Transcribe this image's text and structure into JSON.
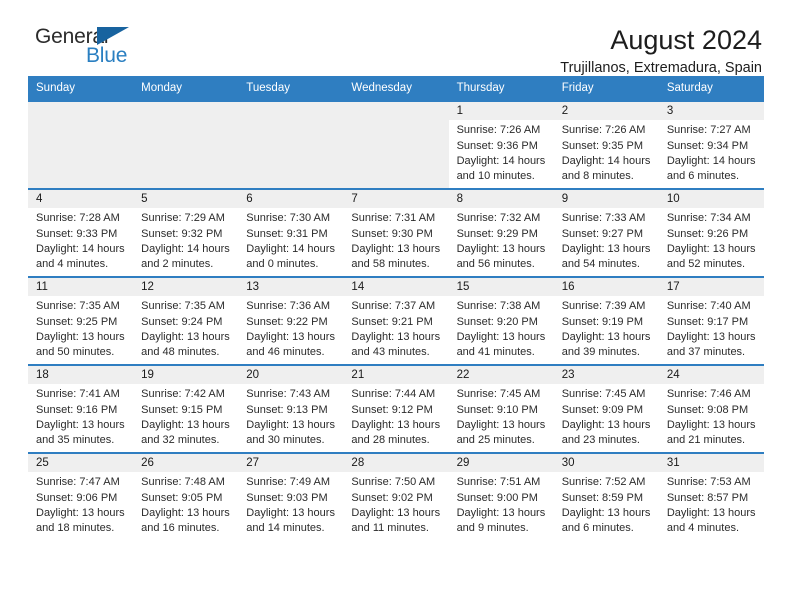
{
  "logo": {
    "word_one": "General",
    "word_two": "Blue",
    "triangle_icon": "triangle-icon"
  },
  "header": {
    "title": "August 2024",
    "subtitle": "Trujillanos, Extremadura, Spain"
  },
  "colors": {
    "header_blue": "#2f7ec1",
    "logo_blue": "#2a7fc1",
    "row_divider": "#2f7ec1",
    "daynum_band": "#efefef"
  },
  "calendar": {
    "weekday_headers": [
      "Sunday",
      "Monday",
      "Tuesday",
      "Wednesday",
      "Thursday",
      "Friday",
      "Saturday"
    ],
    "weeks": [
      [
        {
          "empty": true,
          "day": "",
          "sunrise": "",
          "sunset": "",
          "daylight1": "",
          "daylight2": ""
        },
        {
          "empty": true,
          "day": "",
          "sunrise": "",
          "sunset": "",
          "daylight1": "",
          "daylight2": ""
        },
        {
          "empty": true,
          "day": "",
          "sunrise": "",
          "sunset": "",
          "daylight1": "",
          "daylight2": ""
        },
        {
          "empty": true,
          "day": "",
          "sunrise": "",
          "sunset": "",
          "daylight1": "",
          "daylight2": ""
        },
        {
          "empty": false,
          "day": "1",
          "sunrise": "Sunrise: 7:26 AM",
          "sunset": "Sunset: 9:36 PM",
          "daylight1": "Daylight: 14 hours",
          "daylight2": "and 10 minutes."
        },
        {
          "empty": false,
          "day": "2",
          "sunrise": "Sunrise: 7:26 AM",
          "sunset": "Sunset: 9:35 PM",
          "daylight1": "Daylight: 14 hours",
          "daylight2": "and 8 minutes."
        },
        {
          "empty": false,
          "day": "3",
          "sunrise": "Sunrise: 7:27 AM",
          "sunset": "Sunset: 9:34 PM",
          "daylight1": "Daylight: 14 hours",
          "daylight2": "and 6 minutes."
        }
      ],
      [
        {
          "empty": false,
          "day": "4",
          "sunrise": "Sunrise: 7:28 AM",
          "sunset": "Sunset: 9:33 PM",
          "daylight1": "Daylight: 14 hours",
          "daylight2": "and 4 minutes."
        },
        {
          "empty": false,
          "day": "5",
          "sunrise": "Sunrise: 7:29 AM",
          "sunset": "Sunset: 9:32 PM",
          "daylight1": "Daylight: 14 hours",
          "daylight2": "and 2 minutes."
        },
        {
          "empty": false,
          "day": "6",
          "sunrise": "Sunrise: 7:30 AM",
          "sunset": "Sunset: 9:31 PM",
          "daylight1": "Daylight: 14 hours",
          "daylight2": "and 0 minutes."
        },
        {
          "empty": false,
          "day": "7",
          "sunrise": "Sunrise: 7:31 AM",
          "sunset": "Sunset: 9:30 PM",
          "daylight1": "Daylight: 13 hours",
          "daylight2": "and 58 minutes."
        },
        {
          "empty": false,
          "day": "8",
          "sunrise": "Sunrise: 7:32 AM",
          "sunset": "Sunset: 9:29 PM",
          "daylight1": "Daylight: 13 hours",
          "daylight2": "and 56 minutes."
        },
        {
          "empty": false,
          "day": "9",
          "sunrise": "Sunrise: 7:33 AM",
          "sunset": "Sunset: 9:27 PM",
          "daylight1": "Daylight: 13 hours",
          "daylight2": "and 54 minutes."
        },
        {
          "empty": false,
          "day": "10",
          "sunrise": "Sunrise: 7:34 AM",
          "sunset": "Sunset: 9:26 PM",
          "daylight1": "Daylight: 13 hours",
          "daylight2": "and 52 minutes."
        }
      ],
      [
        {
          "empty": false,
          "day": "11",
          "sunrise": "Sunrise: 7:35 AM",
          "sunset": "Sunset: 9:25 PM",
          "daylight1": "Daylight: 13 hours",
          "daylight2": "and 50 minutes."
        },
        {
          "empty": false,
          "day": "12",
          "sunrise": "Sunrise: 7:35 AM",
          "sunset": "Sunset: 9:24 PM",
          "daylight1": "Daylight: 13 hours",
          "daylight2": "and 48 minutes."
        },
        {
          "empty": false,
          "day": "13",
          "sunrise": "Sunrise: 7:36 AM",
          "sunset": "Sunset: 9:22 PM",
          "daylight1": "Daylight: 13 hours",
          "daylight2": "and 46 minutes."
        },
        {
          "empty": false,
          "day": "14",
          "sunrise": "Sunrise: 7:37 AM",
          "sunset": "Sunset: 9:21 PM",
          "daylight1": "Daylight: 13 hours",
          "daylight2": "and 43 minutes."
        },
        {
          "empty": false,
          "day": "15",
          "sunrise": "Sunrise: 7:38 AM",
          "sunset": "Sunset: 9:20 PM",
          "daylight1": "Daylight: 13 hours",
          "daylight2": "and 41 minutes."
        },
        {
          "empty": false,
          "day": "16",
          "sunrise": "Sunrise: 7:39 AM",
          "sunset": "Sunset: 9:19 PM",
          "daylight1": "Daylight: 13 hours",
          "daylight2": "and 39 minutes."
        },
        {
          "empty": false,
          "day": "17",
          "sunrise": "Sunrise: 7:40 AM",
          "sunset": "Sunset: 9:17 PM",
          "daylight1": "Daylight: 13 hours",
          "daylight2": "and 37 minutes."
        }
      ],
      [
        {
          "empty": false,
          "day": "18",
          "sunrise": "Sunrise: 7:41 AM",
          "sunset": "Sunset: 9:16 PM",
          "daylight1": "Daylight: 13 hours",
          "daylight2": "and 35 minutes."
        },
        {
          "empty": false,
          "day": "19",
          "sunrise": "Sunrise: 7:42 AM",
          "sunset": "Sunset: 9:15 PM",
          "daylight1": "Daylight: 13 hours",
          "daylight2": "and 32 minutes."
        },
        {
          "empty": false,
          "day": "20",
          "sunrise": "Sunrise: 7:43 AM",
          "sunset": "Sunset: 9:13 PM",
          "daylight1": "Daylight: 13 hours",
          "daylight2": "and 30 minutes."
        },
        {
          "empty": false,
          "day": "21",
          "sunrise": "Sunrise: 7:44 AM",
          "sunset": "Sunset: 9:12 PM",
          "daylight1": "Daylight: 13 hours",
          "daylight2": "and 28 minutes."
        },
        {
          "empty": false,
          "day": "22",
          "sunrise": "Sunrise: 7:45 AM",
          "sunset": "Sunset: 9:10 PM",
          "daylight1": "Daylight: 13 hours",
          "daylight2": "and 25 minutes."
        },
        {
          "empty": false,
          "day": "23",
          "sunrise": "Sunrise: 7:45 AM",
          "sunset": "Sunset: 9:09 PM",
          "daylight1": "Daylight: 13 hours",
          "daylight2": "and 23 minutes."
        },
        {
          "empty": false,
          "day": "24",
          "sunrise": "Sunrise: 7:46 AM",
          "sunset": "Sunset: 9:08 PM",
          "daylight1": "Daylight: 13 hours",
          "daylight2": "and 21 minutes."
        }
      ],
      [
        {
          "empty": false,
          "day": "25",
          "sunrise": "Sunrise: 7:47 AM",
          "sunset": "Sunset: 9:06 PM",
          "daylight1": "Daylight: 13 hours",
          "daylight2": "and 18 minutes."
        },
        {
          "empty": false,
          "day": "26",
          "sunrise": "Sunrise: 7:48 AM",
          "sunset": "Sunset: 9:05 PM",
          "daylight1": "Daylight: 13 hours",
          "daylight2": "and 16 minutes."
        },
        {
          "empty": false,
          "day": "27",
          "sunrise": "Sunrise: 7:49 AM",
          "sunset": "Sunset: 9:03 PM",
          "daylight1": "Daylight: 13 hours",
          "daylight2": "and 14 minutes."
        },
        {
          "empty": false,
          "day": "28",
          "sunrise": "Sunrise: 7:50 AM",
          "sunset": "Sunset: 9:02 PM",
          "daylight1": "Daylight: 13 hours",
          "daylight2": "and 11 minutes."
        },
        {
          "empty": false,
          "day": "29",
          "sunrise": "Sunrise: 7:51 AM",
          "sunset": "Sunset: 9:00 PM",
          "daylight1": "Daylight: 13 hours",
          "daylight2": "and 9 minutes."
        },
        {
          "empty": false,
          "day": "30",
          "sunrise": "Sunrise: 7:52 AM",
          "sunset": "Sunset: 8:59 PM",
          "daylight1": "Daylight: 13 hours",
          "daylight2": "and 6 minutes."
        },
        {
          "empty": false,
          "day": "31",
          "sunrise": "Sunrise: 7:53 AM",
          "sunset": "Sunset: 8:57 PM",
          "daylight1": "Daylight: 13 hours",
          "daylight2": "and 4 minutes."
        }
      ]
    ]
  }
}
